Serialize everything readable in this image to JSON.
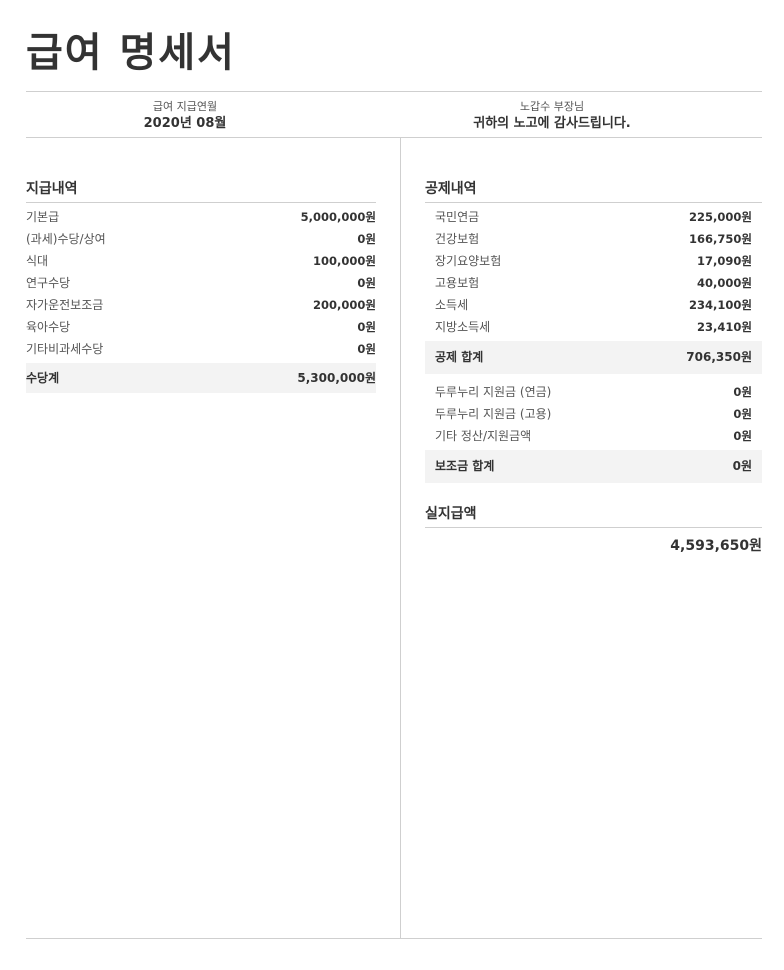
{
  "title": "급여 명세서",
  "header": {
    "period_label": "급여 지급연월",
    "period_value": "2020년 08월",
    "recipient": "노갑수 부장님",
    "thanks": "귀하의 노고에 감사드립니다."
  },
  "payments": {
    "section_title": "지급내역",
    "items": [
      {
        "label": "기본급",
        "amount": "5,000,000원"
      },
      {
        "label": "(과세)수당/상여",
        "amount": "0원"
      },
      {
        "label": "식대",
        "amount": "100,000원"
      },
      {
        "label": "연구수당",
        "amount": "0원"
      },
      {
        "label": "자가운전보조금",
        "amount": "200,000원"
      },
      {
        "label": "육아수당",
        "amount": "0원"
      },
      {
        "label": "기타비과세수당",
        "amount": "0원"
      }
    ],
    "total_label": "수당계",
    "total_amount": "5,300,000원"
  },
  "deductions": {
    "section_title": "공제내역",
    "items": [
      {
        "label": "국민연금",
        "amount": "225,000원"
      },
      {
        "label": "건강보험",
        "amount": "166,750원"
      },
      {
        "label": "장기요양보험",
        "amount": "17,090원"
      },
      {
        "label": "고용보험",
        "amount": "40,000원"
      },
      {
        "label": "소득세",
        "amount": "234,100원"
      },
      {
        "label": "지방소득세",
        "amount": "23,410원"
      }
    ],
    "total_label": "공제 합계",
    "total_amount": "706,350원",
    "subsidies": [
      {
        "label": "두루누리 지원금 (연금)",
        "amount": "0원"
      },
      {
        "label": "두루누리 지원금 (고용)",
        "amount": "0원"
      },
      {
        "label": "기타 정산/지원금액",
        "amount": "0원"
      }
    ],
    "subsidy_total_label": "보조금 합계",
    "subsidy_total_amount": "0원"
  },
  "net_pay": {
    "section_title": "실지급액",
    "amount": "4,593,650원"
  }
}
